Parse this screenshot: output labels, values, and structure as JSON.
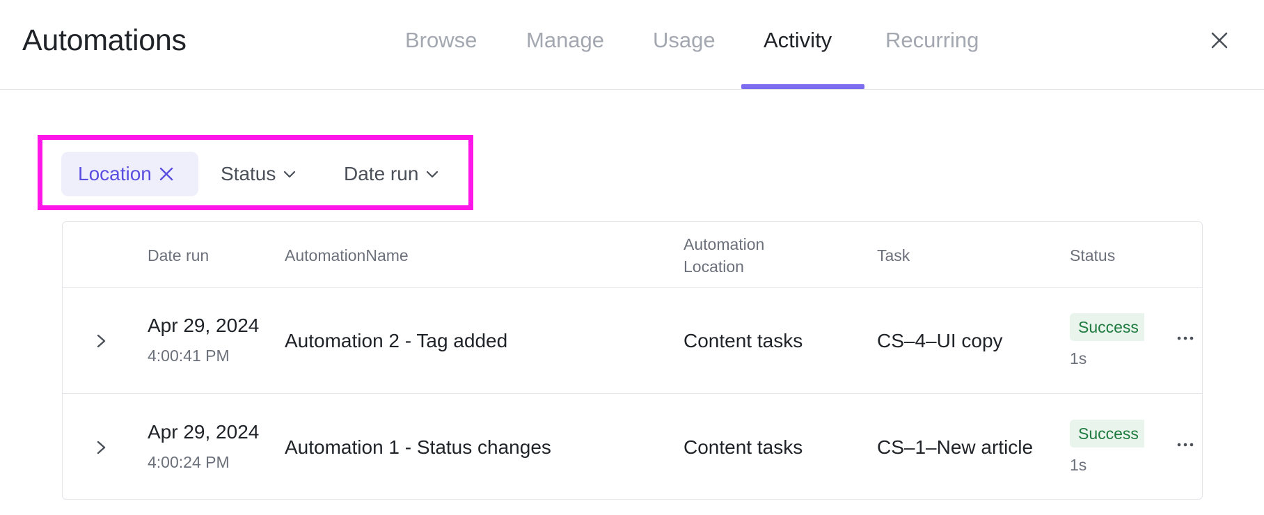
{
  "header": {
    "title": "Automations",
    "tabs": [
      {
        "label": "Browse",
        "active": false
      },
      {
        "label": "Manage",
        "active": false
      },
      {
        "label": "Usage",
        "active": false
      },
      {
        "label": "Activity",
        "active": true
      },
      {
        "label": "Recurring",
        "active": false
      }
    ],
    "close_icon": "close-icon"
  },
  "filters": {
    "location": {
      "label": "Location",
      "icon": "close-icon",
      "active": true
    },
    "status": {
      "label": "Status",
      "icon": "chevron-down-icon"
    },
    "date_run": {
      "label": "Date run",
      "icon": "chevron-down-icon"
    }
  },
  "table": {
    "columns": {
      "date_run": "Date run",
      "automation_name": "AutomationName",
      "automation_location_line1": "Automation",
      "automation_location_line2": "Location",
      "task": "Task",
      "status": "Status"
    },
    "rows": [
      {
        "date": "Apr 29, 2024",
        "time": "4:00:41 PM",
        "name": "Automation 2 - Tag added",
        "location": "Content tasks",
        "task": "CS–4–UI copy",
        "status": "Success",
        "duration": "1s"
      },
      {
        "date": "Apr 29, 2024",
        "time": "4:00:24 PM",
        "name": "Automation 1 - Status changes",
        "location": "Content tasks",
        "task": "CS–1–New article",
        "status": "Success",
        "duration": "1s"
      }
    ]
  },
  "colors": {
    "accent": "#7b6cf0",
    "chip_text": "#5a4ee0",
    "chip_bg": "#efeffb",
    "success_text": "#1e7a3f",
    "success_bg": "#e8f4ec",
    "highlight": "#ff16e8"
  }
}
